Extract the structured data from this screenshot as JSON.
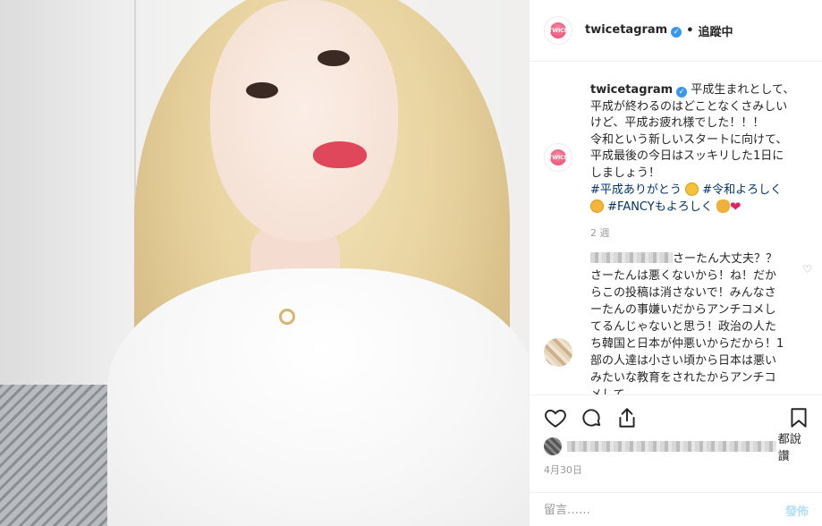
{
  "header": {
    "username": "twicetagram",
    "dot": "•",
    "follow_label": "追蹤中",
    "avatar_text": "TWICE"
  },
  "caption": {
    "username": "twicetagram",
    "text": "平成生まれとして、\n平成が終わるのはどことなくさみしい\nけど、平成お疲れ様でした！！！\n令和という新しいスタートに向けて、\n平成最後の今日はスッキリした1日に\nしましょう！",
    "tag1": "#平成ありがとう",
    "tag2": "#令和よろしく",
    "tag3": "#FANCYもよろしく",
    "time": "2 週"
  },
  "comment": {
    "first": "さーたん大丈",
    "rest": "夫？？さーたんは悪くないから！ね！だからこの投稿は消さないで！みんなさーたんの事嫌いだからアンチコメしてるんじゃないと思う！政治の人たち韓国と日本が仲悪いからだから！1部の人達は小さい頃から日本は悪いみたいな教育をされたからアンチコメして"
  },
  "actions": {
    "likes_suffix": "都說讚",
    "date": "4月30日"
  },
  "add_comment": {
    "placeholder": "留言……",
    "post_label": "發佈"
  },
  "icons": [
    "heart-icon",
    "comment-icon",
    "share-icon",
    "bookmark-icon",
    "verified-badge-icon",
    "small-heart-icon"
  ],
  "colors": {
    "link": "#003569",
    "verified": "#3897f0",
    "muted": "#999999",
    "post_button": "#b2dffc"
  }
}
